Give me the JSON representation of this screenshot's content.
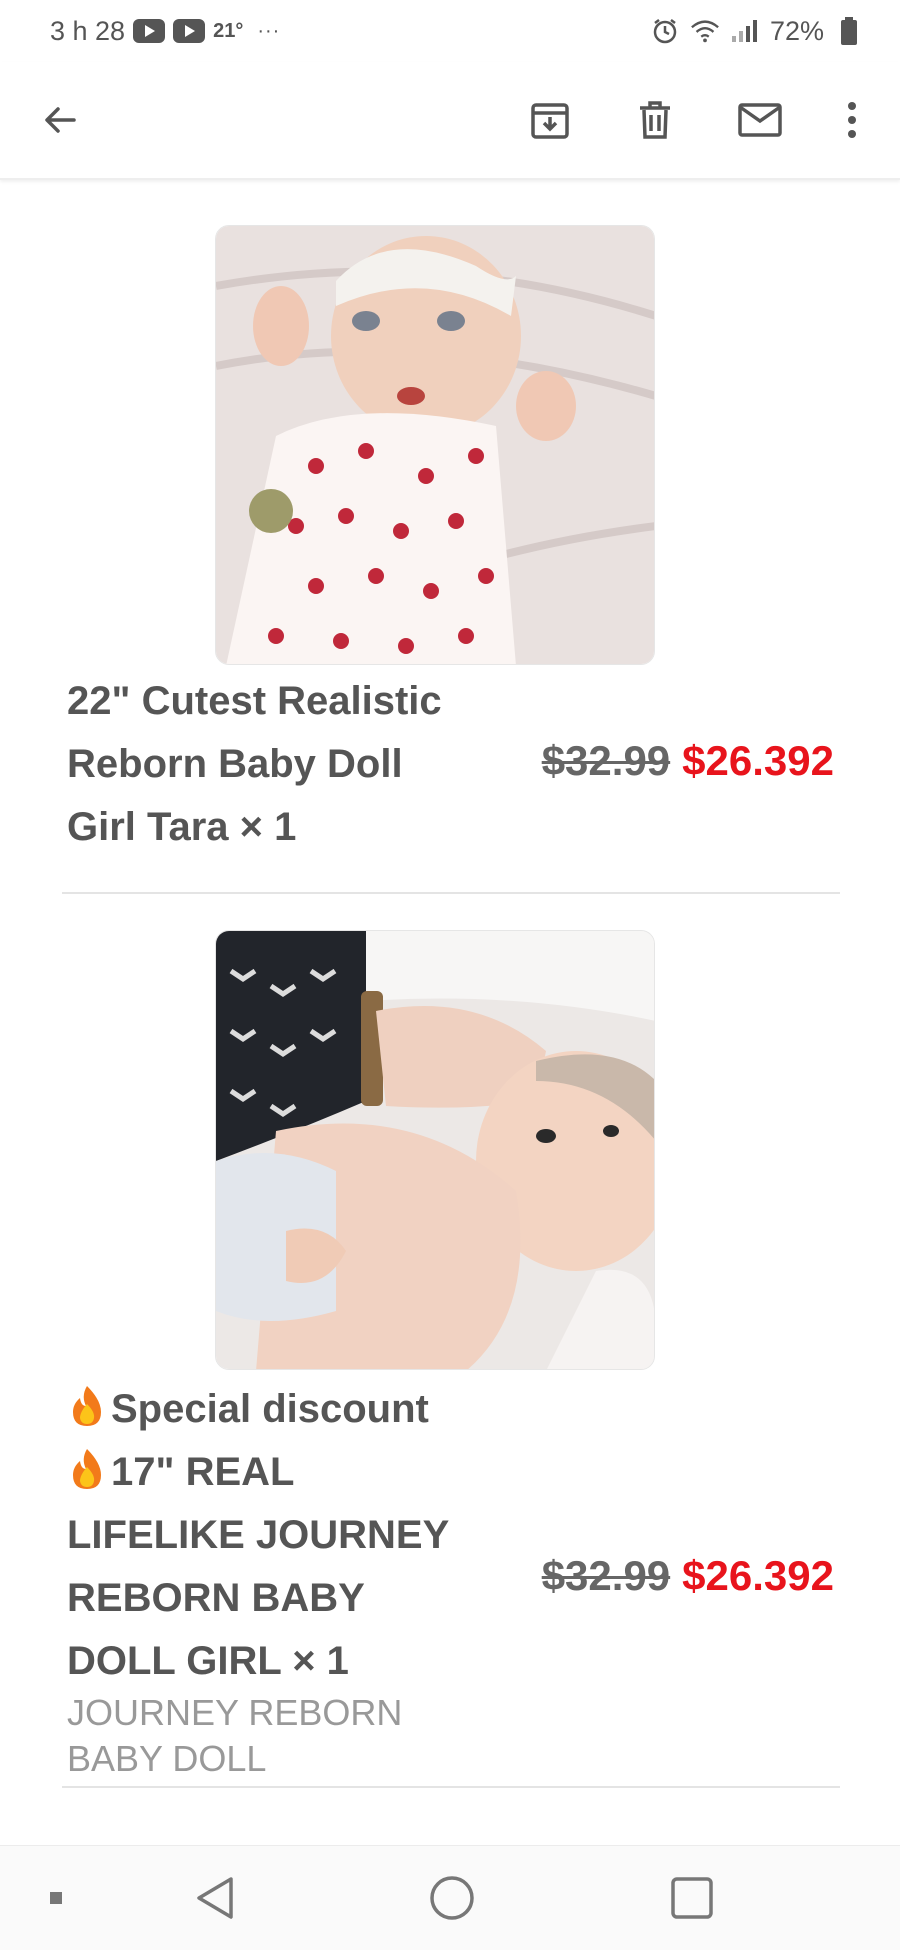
{
  "status_bar": {
    "time": "3 h 28",
    "temperature": "21°",
    "more": "···",
    "battery": "72%"
  },
  "toolbar": {
    "icons": [
      "back-arrow-icon",
      "archive-icon",
      "delete-icon",
      "mark-unread-icon",
      "more-vert-icon"
    ]
  },
  "products": [
    {
      "name_lines": [
        "22\" Cutest Realistic",
        "Reborn Baby Doll",
        "Girl Tara × 1"
      ],
      "old_price": "$32.99",
      "new_price": "$26.392"
    },
    {
      "name_lines": [
        "Special discount",
        "17\" REAL",
        "LIFELIKE JOURNEY",
        "REBORN BABY",
        "DOLL GIRL × 1"
      ],
      "subtitle_lines": [
        "JOURNEY REBORN",
        "BABY DOLL"
      ],
      "old_price": "$32.99",
      "new_price": "$26.392"
    }
  ],
  "colors": {
    "sale_price": "#e8141c",
    "text": "#555555",
    "muted": "#999999"
  }
}
